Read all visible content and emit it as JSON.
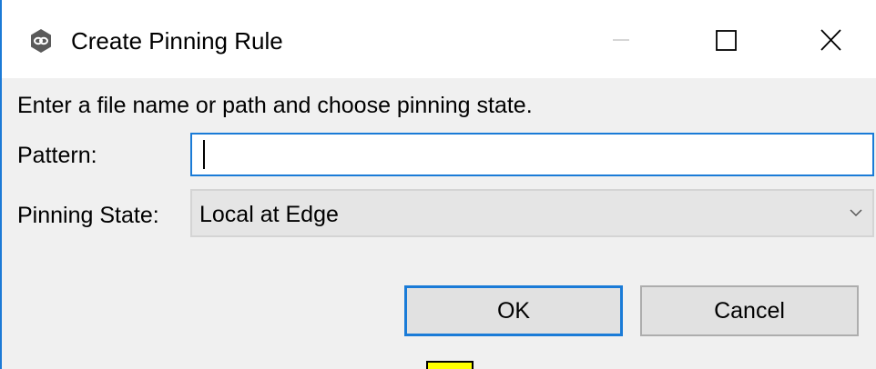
{
  "window": {
    "title": "Create Pinning Rule",
    "app_icon": "app-logo-icon",
    "controls": {
      "minimize_icon": "minimize-icon",
      "maximize_icon": "maximize-icon",
      "close_icon": "close-icon"
    }
  },
  "form": {
    "instruction": "Enter a file name or path and choose pinning state.",
    "pattern": {
      "label": "Pattern:",
      "value": ""
    },
    "pinning_state": {
      "label": "Pinning State:",
      "selected": "Local at Edge"
    }
  },
  "buttons": {
    "ok_label": "OK",
    "cancel_label": "Cancel"
  },
  "colors": {
    "accent": "#1a7bd7",
    "button_bg": "#e1e1e1",
    "dialog_bg": "#f0f0f0",
    "marker": "#ffff00"
  }
}
